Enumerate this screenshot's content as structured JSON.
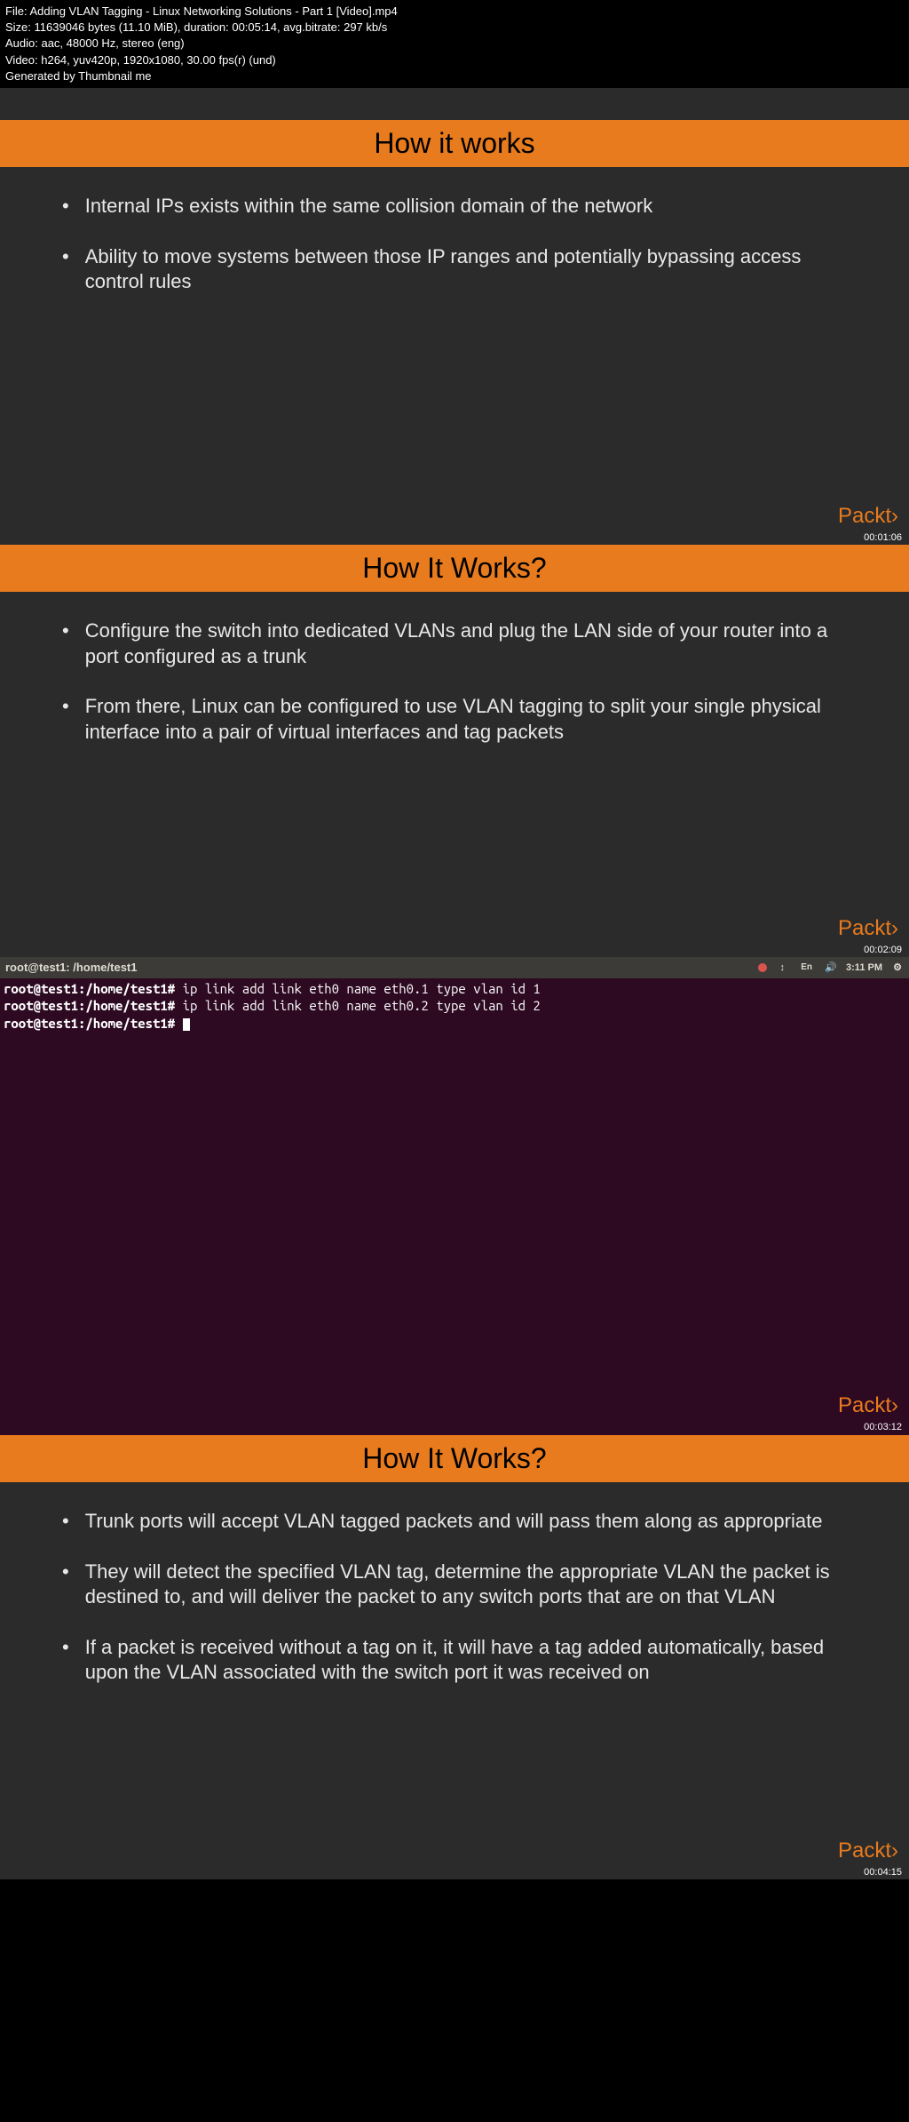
{
  "metadata": {
    "line1": "File: Adding VLAN Tagging - Linux Networking Solutions - Part 1 [Video].mp4",
    "line2": "Size: 11639046 bytes (11.10 MiB), duration: 00:05:14, avg.bitrate: 297 kb/s",
    "line3": "Audio: aac, 48000 Hz, stereo (eng)",
    "line4": "Video: h264, yuv420p, 1920x1080, 30.00 fps(r) (und)",
    "line5": "Generated by Thumbnail me"
  },
  "slides": [
    {
      "title": "How it works",
      "bullets": [
        "Internal IPs exists within the same collision domain of the network",
        "Ability to move systems between those IP ranges and potentially bypassing access control rules"
      ],
      "logo": "Packt›",
      "timestamp": "00:01:06"
    },
    {
      "title": "How It Works?",
      "bullets": [
        "Configure the switch into dedicated VLANs and plug the LAN side of your router into a port configured as a trunk",
        "From there, Linux can be configured to use VLAN tagging to split your single physical interface into a pair of virtual interfaces and tag packets"
      ],
      "logo": "Packt›",
      "timestamp": "00:02:09"
    },
    {
      "title": "How It Works?",
      "bullets": [
        "Trunk ports will accept VLAN tagged packets and will pass them along as appropriate",
        "They will detect the specified VLAN tag, determine the appropriate VLAN the packet is destined to, and will deliver the packet to any switch ports that are on that VLAN",
        "If a packet is received without a tag on it, it will have a tag added automatically, based upon the VLAN associated with the switch port it was received on"
      ],
      "logo": "Packt›",
      "timestamp": "00:04:15"
    }
  ],
  "terminal": {
    "titlebar": "root@test1: /home/test1",
    "time": "3:11 PM",
    "lang": "En",
    "lines": [
      {
        "prompt": "root@test1:/home/test1#",
        "cmd": " ip link add link eth0 name eth0.1 type vlan id 1"
      },
      {
        "prompt": "root@test1:/home/test1#",
        "cmd": " ip link add link eth0 name eth0.2 type vlan id 2"
      },
      {
        "prompt": "root@test1:/home/test1#",
        "cmd": " "
      }
    ],
    "logo": "Packt›",
    "timestamp": "00:03:12"
  }
}
